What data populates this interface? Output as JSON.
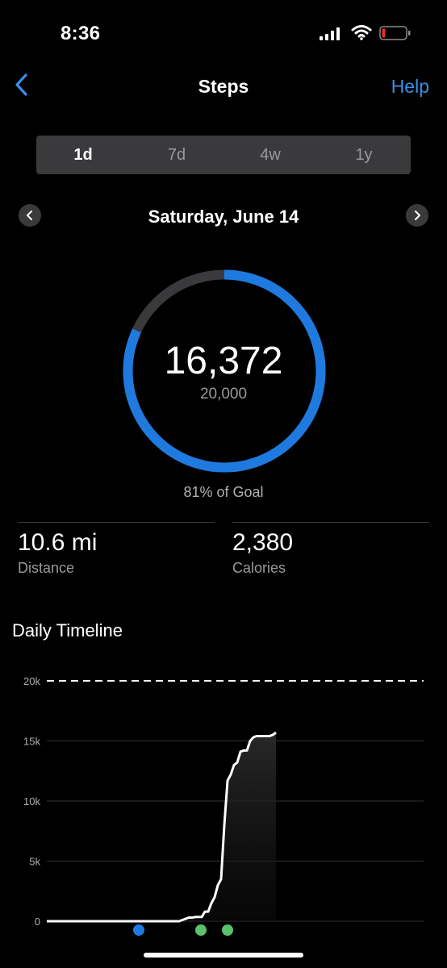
{
  "status_bar": {
    "time": "8:36",
    "icons": [
      "cellular-signal-icon",
      "wifi-icon",
      "battery-low-icon"
    ]
  },
  "nav": {
    "back_icon": "chevron-left-icon",
    "title": "Steps",
    "help_label": "Help"
  },
  "period_tabs": [
    {
      "label": "1d",
      "active": true
    },
    {
      "label": "7d",
      "active": false
    },
    {
      "label": "4w",
      "active": false
    },
    {
      "label": "1y",
      "active": false
    }
  ],
  "date_nav": {
    "prev_icon": "chevron-left-icon",
    "next_icon": "chevron-right-icon",
    "label": "Saturday, June 14"
  },
  "summary": {
    "steps": "16,372",
    "goal": "20,000",
    "progress": 0.8186,
    "goal_text": "81% of Goal"
  },
  "stats": {
    "distance_value": "10.6 mi",
    "distance_label": "Distance",
    "calories_value": "2,380",
    "calories_label": "Calories"
  },
  "timeline": {
    "title": "Daily Timeline"
  },
  "colors": {
    "accent": "#1f7ae0",
    "link": "#3a8ee6",
    "background": "#000000",
    "ring_track": "#3a3a3c",
    "battery_low": "#e5332a"
  },
  "chart_data": {
    "type": "line",
    "ylim": [
      0,
      20000
    ],
    "yticks": [
      "0",
      "5k",
      "10k",
      "15k",
      "20k"
    ],
    "goal_line": 20000,
    "grid": true,
    "y": [
      0,
      0,
      0,
      0,
      0,
      0,
      0,
      0,
      0,
      0,
      0,
      0,
      0,
      0,
      0,
      0,
      0,
      0,
      0,
      0,
      0,
      0,
      0,
      0,
      0,
      0,
      0,
      0,
      0,
      0,
      0,
      0,
      0,
      0,
      0,
      0,
      0,
      0,
      0,
      0,
      0,
      0,
      100,
      200,
      300,
      300,
      350,
      350,
      350,
      800,
      800,
      1500,
      2000,
      3000,
      3500,
      8000,
      11700,
      12200,
      13000,
      13200,
      14100,
      14200,
      14200,
      15000,
      15300,
      15400,
      15400,
      15400,
      15400,
      15400,
      15500,
      15700
    ]
  }
}
